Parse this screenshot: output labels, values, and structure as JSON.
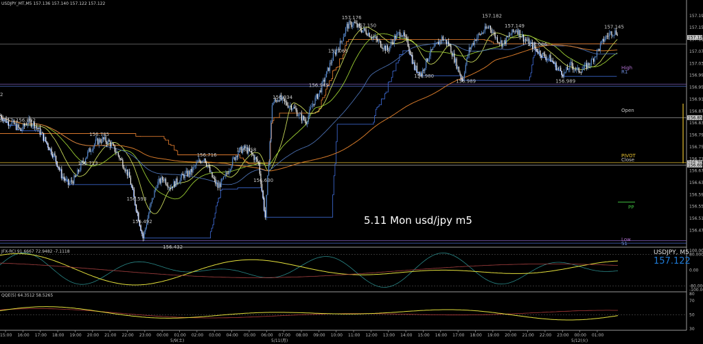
{
  "header": {
    "main": "USDJPY_MT,M5  157.136 157.140 157.122 157.122",
    "rci": "JFX-RCI 91.6667 72.9482 -7.1118",
    "qqe": "QQE(5) 64.3512 58.5265"
  },
  "annotation": "5.11 Mon usd/jpy m5",
  "price_box": {
    "symbol": "USDJPY, M5",
    "price": "157.122"
  },
  "left_edge_label": "2",
  "level_labels": {
    "high": "High",
    "r1": "R1",
    "open": "Open",
    "pivot": "PIVOT",
    "close": "Close",
    "pp": "PP",
    "low": "Low",
    "s1": "S1"
  },
  "colors": {
    "bull": "#5b8fd6",
    "bear": "#ffffff",
    "ma_green": "#9acd32",
    "ma_yellow_green": "#c8d85a",
    "ma_blue": "#4a6fb0",
    "ma_orange": "#d67a2a",
    "step_blue": "#3a64c8",
    "step_orange": "#d9772c",
    "rci_yellow": "#e6e23c",
    "rci_teal": "#2a8a8a",
    "rci_red": "#a84040",
    "qqe_yellow": "#e6e23c",
    "qqe_red": "#b23a3a",
    "price_blue": "#1e7ad6"
  },
  "chart_data": [
    {
      "type": "candlestick",
      "title": "USDJPY_MT,M5",
      "ylim": [
        156.43,
        157.22
      ],
      "y_ticks": [
        "157.195",
        "157.155",
        "157.115",
        "157.075",
        "157.035",
        "156.995",
        "156.955",
        "156.915",
        "156.875",
        "156.835",
        "156.795",
        "156.755",
        "156.715",
        "156.675",
        "156.635",
        "156.595",
        "156.555",
        "156.515",
        "156.475"
      ],
      "x_ticks": [
        "15:00",
        "16:00",
        "17:00",
        "18:00",
        "19:00",
        "20:00",
        "21:00",
        "22:00",
        "23:00",
        "00:00",
        "01:00",
        "02:00",
        "03:00",
        "04:00",
        "05:00",
        "06:00",
        "07:00",
        "08:00",
        "09:00",
        "10:00",
        "11:00",
        "12:00",
        "13:00",
        "14:00",
        "15:00",
        "16:00",
        "17:00",
        "18:00",
        "19:00",
        "20:00",
        "21:00",
        "22:00",
        "23:00",
        "00:00",
        "01:00"
      ],
      "date_labels": [
        "5/9(土)",
        "5/11(月)",
        "5/12(火)"
      ],
      "price_labels": [
        {
          "text": "157.176",
          "value": 157.176
        },
        {
          "text": "157.149",
          "value": 157.149
        },
        {
          "text": "157.145",
          "value": 157.145
        },
        {
          "text": "157.182",
          "value": 157.182
        },
        {
          "text": "157.150",
          "value": 157.15
        },
        {
          "text": "157.065",
          "value": 157.065
        },
        {
          "text": "157.086",
          "value": 157.086
        },
        {
          "text": "156.989",
          "value": 156.989
        },
        {
          "text": "156.949",
          "value": 156.949
        },
        {
          "text": "156.989",
          "value": 156.989
        },
        {
          "text": "156.980",
          "value": 156.98
        },
        {
          "text": "156.934",
          "value": 156.934
        },
        {
          "text": "156.832",
          "value": 156.832
        },
        {
          "text": "156.857",
          "value": 156.857
        },
        {
          "text": "156.785",
          "value": 156.785
        },
        {
          "text": "156.758",
          "value": 156.758
        },
        {
          "text": "156.716",
          "value": 156.716
        },
        {
          "text": "156.713",
          "value": 156.713
        },
        {
          "text": "156.630",
          "value": 156.63
        },
        {
          "text": "156.593",
          "value": 156.593
        },
        {
          "text": "156.492",
          "value": 156.492
        },
        {
          "text": "156.432",
          "value": 156.432
        }
      ],
      "right_tags": [
        {
          "text": "157.122",
          "value": 157.122
        },
        {
          "text": "156.853",
          "value": 156.853
        },
        {
          "text": "156.702",
          "value": 156.702
        },
        {
          "text": "156.694",
          "value": 156.694
        }
      ],
      "close_path": [
        156.86,
        156.84,
        156.83,
        156.81,
        156.84,
        156.83,
        156.8,
        156.76,
        156.72,
        156.66,
        156.63,
        156.65,
        156.7,
        156.74,
        156.77,
        156.78,
        156.77,
        156.74,
        156.7,
        156.65,
        156.55,
        156.45,
        156.55,
        156.63,
        156.65,
        156.62,
        156.64,
        156.66,
        156.67,
        156.7,
        156.72,
        156.66,
        156.62,
        156.65,
        156.7,
        156.74,
        156.75,
        156.73,
        156.7,
        156.52,
        156.9,
        156.92,
        156.9,
        156.89,
        156.86,
        156.84,
        156.9,
        156.94,
        157.0,
        157.06,
        157.1,
        157.16,
        157.17,
        157.15,
        157.14,
        157.12,
        157.1,
        157.08,
        157.12,
        157.14,
        157.1,
        157.02,
        157.0,
        157.06,
        157.09,
        157.12,
        157.1,
        157.04,
        156.98,
        157.08,
        157.12,
        157.14,
        157.16,
        157.12,
        157.1,
        157.13,
        157.15,
        157.12,
        157.1,
        157.08,
        157.06,
        157.05,
        157.02,
        157.0,
        157.03,
        157.01,
        157.02,
        157.04,
        157.08,
        157.12,
        157.14
      ]
    },
    {
      "type": "line",
      "title": "JFX-RCI",
      "ylim": [
        -100,
        100
      ],
      "y_ticks": [
        "100.0000",
        "80.0000",
        "0.00",
        "-80.0000",
        "-100.0000"
      ]
    },
    {
      "type": "line",
      "title": "QQE(5)",
      "ylim": [
        30,
        80
      ],
      "y_ticks": [
        "80",
        "70",
        "50",
        "30"
      ]
    }
  ]
}
